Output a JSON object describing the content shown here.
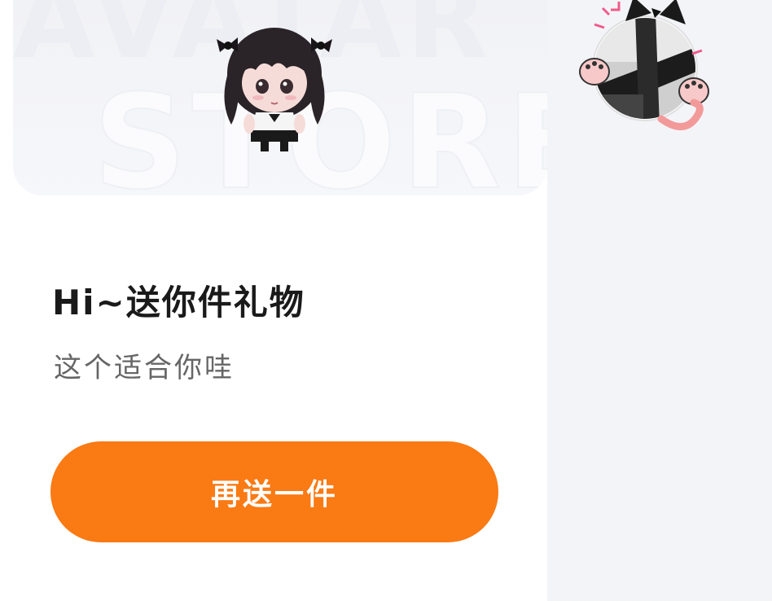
{
  "banner": {
    "watermark_line1": "AVATAR",
    "watermark_line2": "STORE"
  },
  "greeting": {
    "title": "Hi~送你件礼物",
    "subtitle": "这个适合你哇"
  },
  "actions": {
    "send_again_label": "再送一件"
  },
  "colors": {
    "accent": "#fa7a14",
    "card": "#ffffff",
    "background": "#f3f4f8"
  },
  "icons": {
    "gift_avatar": "doll-avatar-icon",
    "user_sticker": "cat-ear-sticker-icon"
  }
}
